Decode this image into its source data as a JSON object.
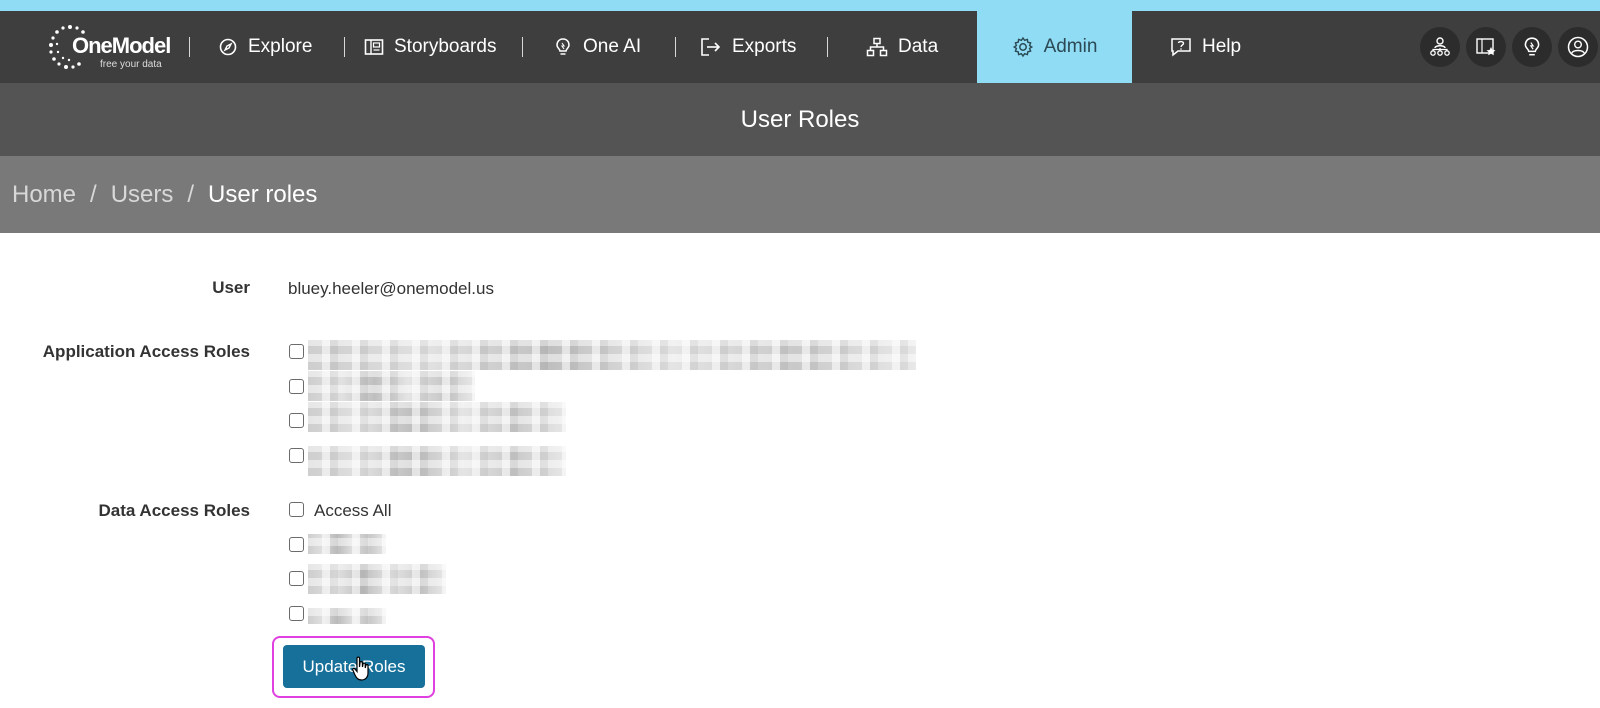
{
  "nav": {
    "logo": {
      "name": "OneModel",
      "tagline": "free your data"
    },
    "items": [
      {
        "label": "Explore",
        "icon": "compass-icon"
      },
      {
        "label": "Storyboards",
        "icon": "storyboard-icon"
      },
      {
        "label": "One AI",
        "icon": "lightbulb-icon"
      },
      {
        "label": "Exports",
        "icon": "export-icon"
      },
      {
        "label": "Data",
        "icon": "sitemap-icon"
      },
      {
        "label": "Admin",
        "icon": "gear-icon",
        "active": true
      },
      {
        "label": "Help",
        "icon": "help-chat-icon"
      }
    ],
    "right_icons": [
      "org-chart-icon",
      "storyboard-star-icon",
      "lightbulb-icon",
      "user-profile-icon"
    ]
  },
  "page": {
    "title": "User Roles"
  },
  "breadcrumb": {
    "home": "Home",
    "users": "Users",
    "current": "User roles",
    "separator": "/"
  },
  "form": {
    "user_label": "User",
    "user_value": "bluey.heeler@onemodel.us",
    "app_roles_label": "Application Access Roles",
    "data_roles_label": "Data Access Roles",
    "access_all_label": "Access All",
    "update_button": "Update Roles"
  },
  "colors": {
    "accent": "#8fdcf4",
    "nav_bg": "#3e3e3e",
    "button": "#16709a",
    "highlight": "#e040e0"
  }
}
